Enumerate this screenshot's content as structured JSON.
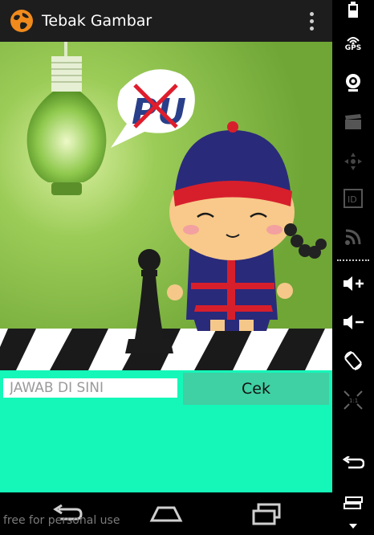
{
  "app": {
    "title": "Tebak Gambar",
    "icon": "globe-icon"
  },
  "actionbar": {
    "overflow_icon": "overflow-menu-icon"
  },
  "puzzle": {
    "bubble_text": "PU",
    "icon": "puzzle-image"
  },
  "answer": {
    "placeholder": "JAWAB DI SINI",
    "value": "",
    "button_label": "Cek"
  },
  "navbar": {
    "back_icon": "back-icon",
    "home_icon": "home-icon",
    "recents_icon": "recents-icon"
  },
  "watermark": "free for personal use",
  "sidebar": {
    "gps_label": "GPS",
    "items": [
      "battery-icon",
      "gps-icon",
      "camera-icon",
      "clapper-icon",
      "dpad-icon",
      "id-icon",
      "rss-icon",
      "volume-up-icon",
      "volume-down-icon",
      "rotate-icon",
      "scale-icon",
      "back-icon",
      "menu-icon"
    ]
  },
  "colors": {
    "content_bg": "#14f7b8",
    "button_bg": "#3fd0a3",
    "picture_bg": "#7cb13a",
    "actionbar": "#1d1d1d"
  }
}
